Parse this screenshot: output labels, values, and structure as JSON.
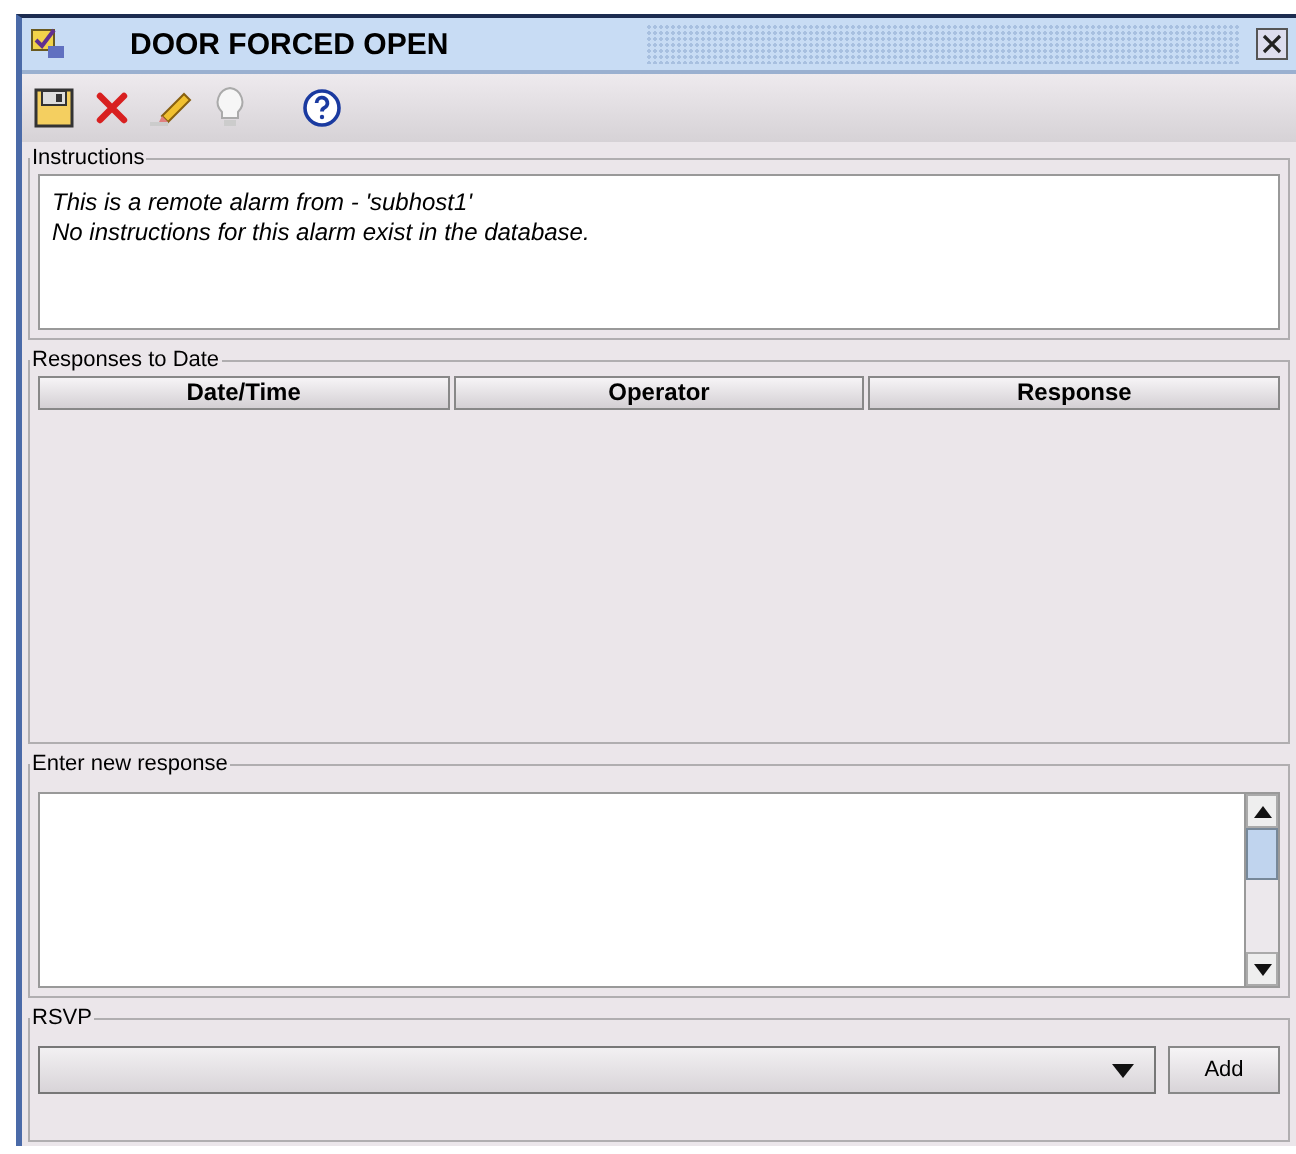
{
  "window": {
    "title": "DOOR FORCED OPEN"
  },
  "instructions": {
    "label": "Instructions",
    "lines": [
      "This is a remote alarm from - 'subhost1'",
      "No instructions for this alarm exist in the database."
    ]
  },
  "responses": {
    "label": "Responses to Date",
    "columns": [
      "Date/Time",
      "Operator",
      "Response"
    ]
  },
  "new_response": {
    "label": "Enter new response"
  },
  "rsvp": {
    "label": "RSVP",
    "button": "Add"
  }
}
